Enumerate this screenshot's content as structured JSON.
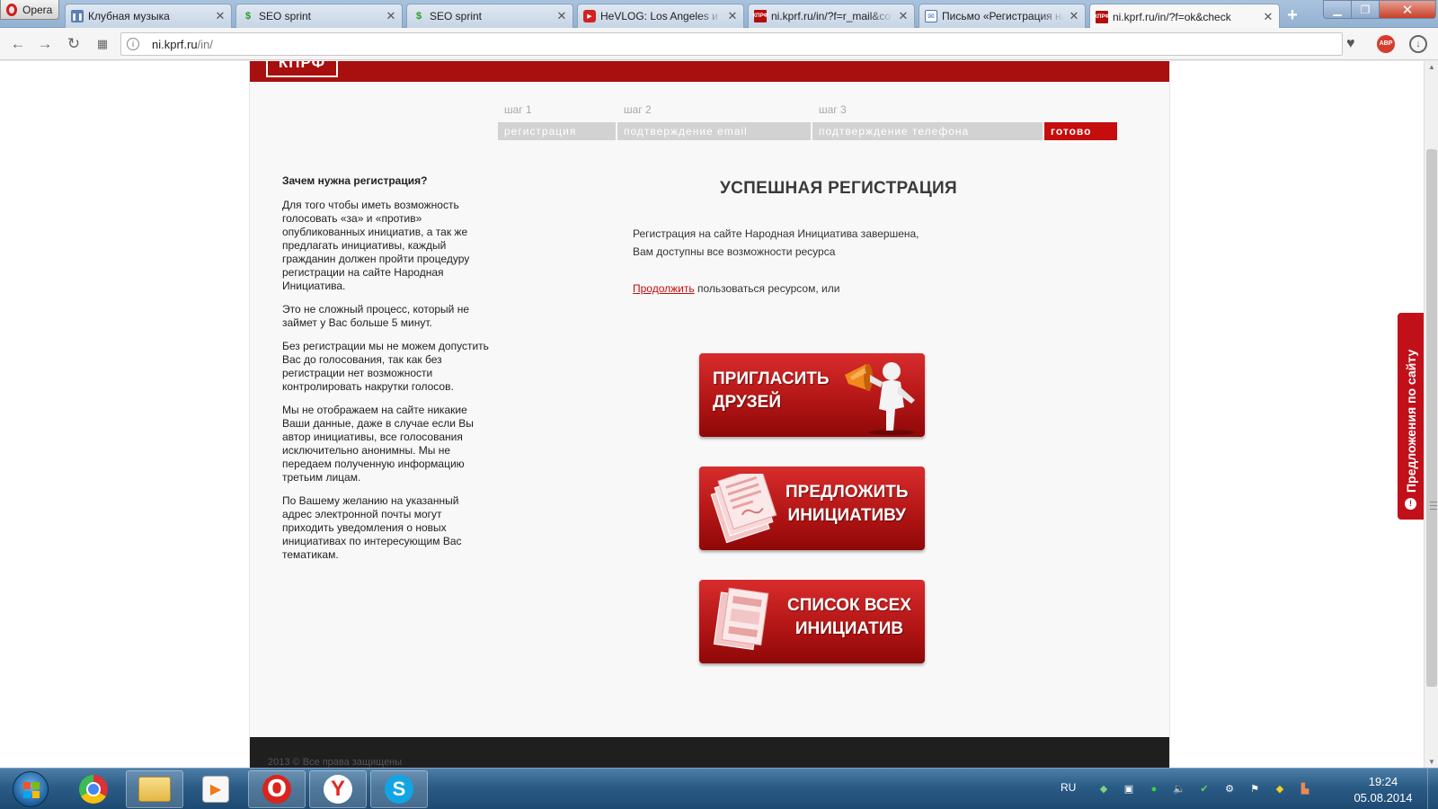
{
  "browser": {
    "menu_label": "Opera",
    "tabs": [
      {
        "label": "Клубная музыка",
        "icon": "pause-icon",
        "active": false
      },
      {
        "label": "SEO sprint",
        "icon": "seosprint-icon",
        "active": false
      },
      {
        "label": "SEO sprint",
        "icon": "seosprint-icon",
        "active": false
      },
      {
        "label": "HeVLOG: Los Angeles и Че",
        "icon": "youtube-icon",
        "active": false
      },
      {
        "label": "ni.kprf.ru/in/?f=r_mail&co",
        "icon": "kprf-icon",
        "active": false
      },
      {
        "label": "Письмо «Регистрация на",
        "icon": "mail-icon",
        "active": false
      },
      {
        "label": "ni.kprf.ru/in/?f=ok&check",
        "icon": "kprf-icon",
        "active": true
      }
    ],
    "url_domain": "ni.kprf.ru",
    "url_path": "/in/",
    "abp_label": "ABP"
  },
  "site": {
    "logo": "КПРФ",
    "steps": [
      {
        "num": "шаг 1",
        "label": "регистрация"
      },
      {
        "num": "шаг 2",
        "label": "подтверждение email"
      },
      {
        "num": "шаг 3",
        "label": "подтверждение телефона"
      },
      {
        "num": "",
        "label": "готово"
      }
    ],
    "sidebar": {
      "heading": "Зачем нужна регистрация?",
      "paragraphs": [
        "Для того чтобы иметь возможность голосовать «за» и «против» опубликованных инициатив, а так же предлагать инициативы, каждый гражданин должен пройти процедуру регистрации на сайте Народная Инициатива.",
        "Это не сложный процесс, который не займет у Вас больше 5 минут.",
        "Без регистрации мы не можем допустить Вас до голосования, так как без регистрации нет возможности контролировать накрутки голосов.",
        "Мы не отображаем на сайте никакие Ваши данные, даже в случае если Вы автор инициативы, все голосования исключительно анонимны. Мы не передаем полученную информацию третьим лицам.",
        "По Вашему желанию на указанный адрес электронной почты могут приходить уведомления о новых инициативах по интересующим Вас тематикам."
      ]
    },
    "main": {
      "title": "УСПЕШНАЯ РЕГИСТРАЦИЯ",
      "text_line1": "Регистрация на сайте Народная Инициатива завершена,",
      "text_line2": "Вам доступны все возможности ресурса",
      "continue_link": "Продолжить",
      "continue_rest": " пользоваться ресурсом, или"
    },
    "buttons": {
      "invite_l1": "ПРИГЛАСИТЬ",
      "invite_l2": "ДРУЗЕЙ",
      "propose_l1": "ПРЕДЛОЖИТЬ",
      "propose_l2": "ИНИЦИАТИВУ",
      "list_l1": "СПИСОК ВСЕХ",
      "list_l2": "ИНИЦИАТИВ"
    },
    "footer": "2013 © Все права защищены",
    "side_tab": "Предложения по сайту"
  },
  "taskbar": {
    "lang": "RU",
    "time": "19:24",
    "date": "05.08.2014",
    "apps": [
      "chrome-icon",
      "explorer-icon",
      "media-player-icon",
      "opera-icon",
      "yandex-icon",
      "skype-icon"
    ]
  },
  "colors": {
    "accent_red": "#a80f0f",
    "step_active": "#c60d0d",
    "step_inactive": "#d2d2d2",
    "link": "#c40d0d"
  }
}
